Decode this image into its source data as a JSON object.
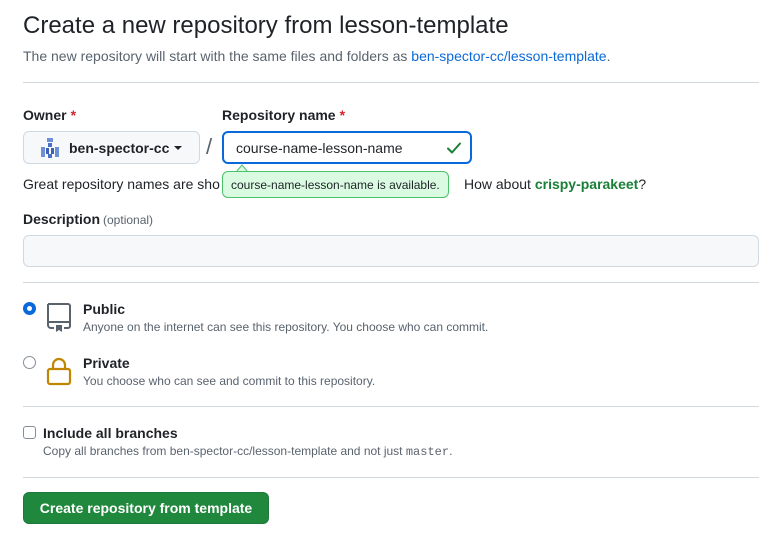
{
  "header": {
    "title": "Create a new repository from lesson-template",
    "subtitle_prefix": "The new repository will start with the same files and folders as ",
    "template_link": "ben-spector-cc/lesson-template",
    "subtitle_suffix": "."
  },
  "owner": {
    "label": "Owner",
    "required_mark": "*",
    "value": "ben-spector-cc"
  },
  "repo_name": {
    "label": "Repository name",
    "required_mark": "*",
    "value": "course-name-lesson-name",
    "availability": "course-name-lesson-name is available."
  },
  "hint": {
    "prefix": "Great repository names are sho",
    "middle": "How about ",
    "suggestion": "crispy-parakeet",
    "suffix": "?"
  },
  "description": {
    "label": "Description",
    "optional": "(optional)",
    "value": ""
  },
  "visibility": {
    "selected": "public",
    "public": {
      "title": "Public",
      "desc": "Anyone on the internet can see this repository. You choose who can commit.",
      "icon": "repo-icon"
    },
    "private": {
      "title": "Private",
      "desc": "You choose who can see and commit to this repository.",
      "icon": "lock-icon"
    }
  },
  "branches": {
    "checked": false,
    "title": "Include all branches",
    "desc_prefix": "Copy all branches from ben-spector-cc/lesson-template and not just ",
    "branch": "master",
    "desc_suffix": "."
  },
  "submit": {
    "label": "Create repository from template"
  },
  "colors": {
    "link": "#0969da",
    "success": "#1a7f37",
    "button": "#1f883d",
    "required": "#d1242f",
    "lock": "#bf8700"
  }
}
